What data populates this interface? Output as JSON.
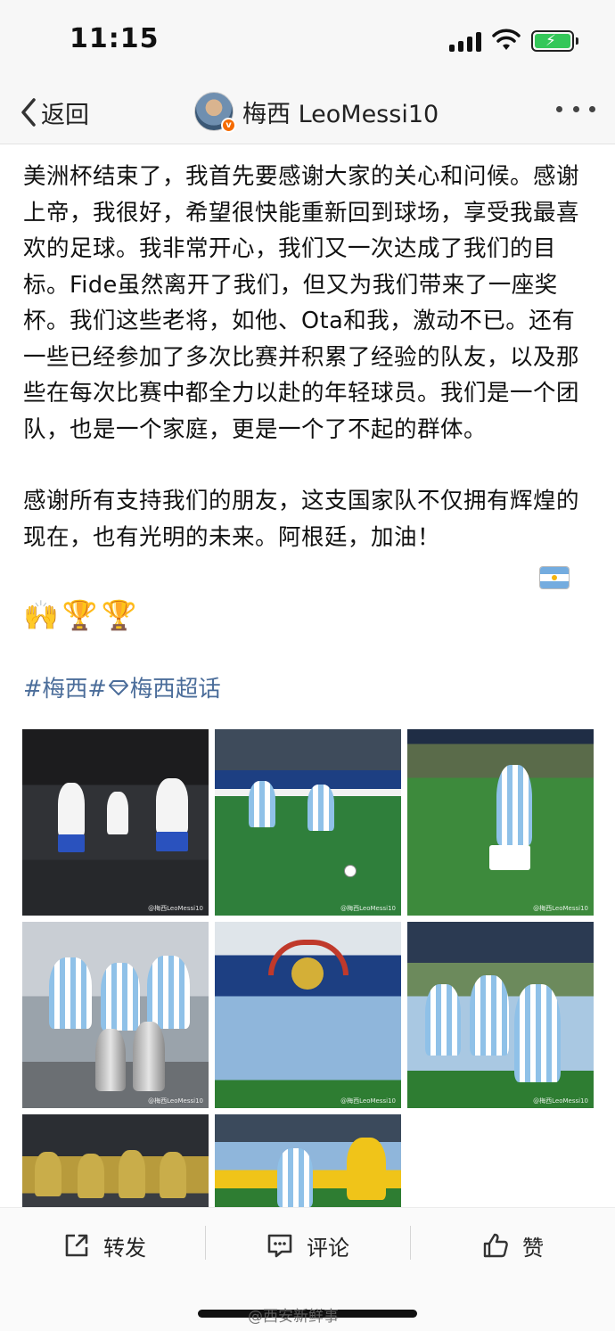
{
  "status_bar": {
    "time": "11:15"
  },
  "nav": {
    "back_label": "返回",
    "username": "梅西 LeoMessi10"
  },
  "post": {
    "paragraph1": "美洲杯结束了，我首先要感谢大家的关心和问候。感谢上帝，我很好，希望很快能重新回到球场，享受我最喜欢的足球。我非常开心，我们又一次达成了我们的目标。Fide虽然离开了我们，但又为我们带来了一座奖杯。我们这些老将，如他、Ota和我，激动不已。还有一些已经参加了多次比赛并积累了经验的队友，以及那些在每次比赛中都全力以赴的年轻球员。我们是一个团队，也是一个家庭，更是一个了不起的群体。",
    "paragraph2": "感谢所有支持我们的朋友，这支国家队不仅拥有辉煌的现在，也有光明的未来。阿根廷，加油！",
    "emojis": [
      "🙌",
      "🏆",
      "🏆"
    ],
    "tag1": "#梅西#",
    "tag2": "梅西超话"
  },
  "photos": {
    "watermark": "@梅西LeoMessi10"
  },
  "actions": {
    "repost": "转发",
    "comment": "评论",
    "like": "赞"
  },
  "footer_watermark": "@西安新鲜事",
  "colors": {
    "link": "#4b6d9a",
    "battery": "#34c759",
    "verified_badge": "#f56b00"
  }
}
